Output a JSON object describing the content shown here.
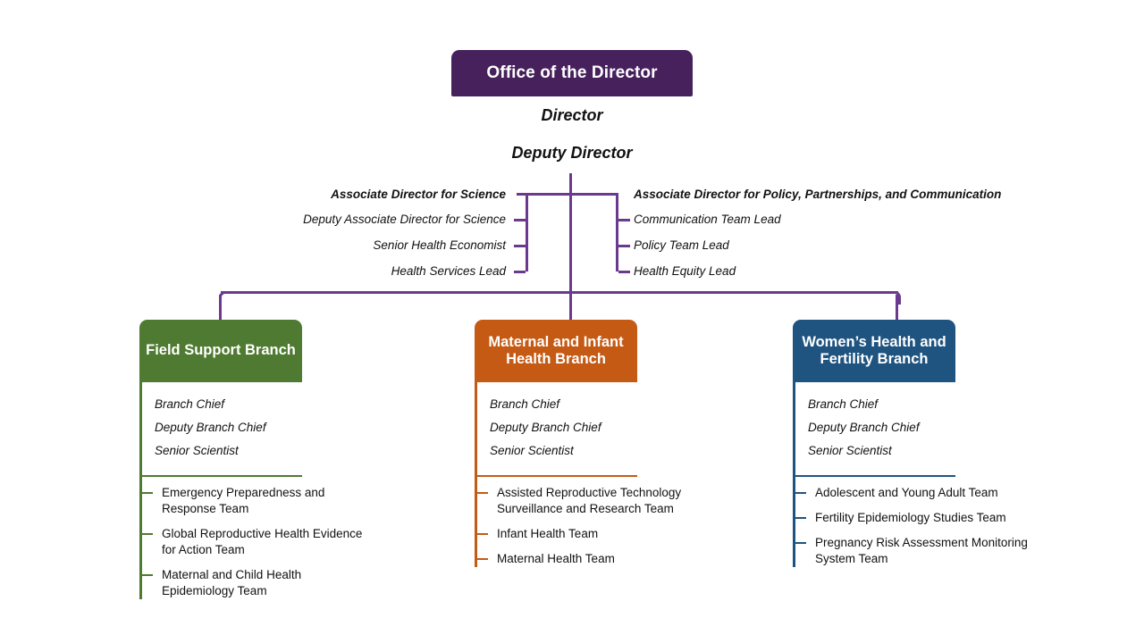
{
  "colors": {
    "purple": "#46215C",
    "purple_line": "#6B3A8E",
    "green": "#4F7A31",
    "orange": "#C55A14",
    "blue": "#1F5480",
    "text": "#111111",
    "white": "#ffffff"
  },
  "top": {
    "office_box_label": "Office of the Director",
    "director_label": "Director",
    "deputy_director_label": "Deputy Director"
  },
  "associate_directors": {
    "left": {
      "head": "Associate Director for Science",
      "reports": [
        "Deputy Associate Director for Science",
        "Senior Health Economist",
        "Health Services Lead"
      ]
    },
    "right": {
      "head": "Associate Director for Policy, Partnerships, and Communication",
      "reports": [
        "Communication Team Lead",
        "Policy Team Lead",
        "Health Equity Lead"
      ]
    }
  },
  "branches": [
    {
      "name": "Field Support Branch",
      "color": "#4F7A31",
      "leads": [
        "Branch Chief",
        "Deputy Branch Chief",
        "Senior Scientist"
      ],
      "teams": [
        "Emergency Preparedness and Response Team",
        "Global Reproductive Health Evidence for Action Team",
        "Maternal and Child Health Epidemiology Team"
      ]
    },
    {
      "name": "Maternal and Infant Health Branch",
      "color": "#C55A14",
      "leads": [
        "Branch Chief",
        "Deputy Branch Chief",
        "Senior Scientist"
      ],
      "teams": [
        "Assisted Reproductive Technology Surveillance and Research Team",
        "Infant Health Team",
        "Maternal Health Team"
      ]
    },
    {
      "name": "Women’s Health and Fertility Branch",
      "color": "#1F5480",
      "leads": [
        "Branch Chief",
        "Deputy Branch Chief",
        "Senior Scientist"
      ],
      "teams": [
        "Adolescent and Young Adult Team",
        "Fertility Epidemiology Studies Team",
        "Pregnancy Risk Assessment Monitoring System Team"
      ]
    }
  ]
}
